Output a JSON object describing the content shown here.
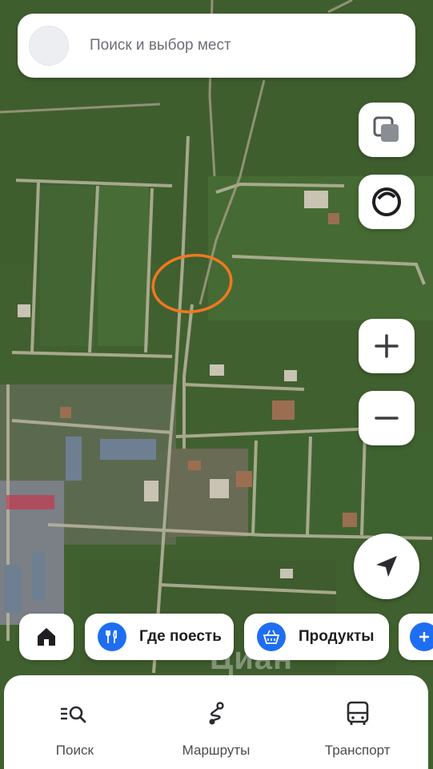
{
  "search": {
    "placeholder": "Поиск и выбор мест",
    "avatar_icon": "avatar-icon"
  },
  "map_controls": {
    "layers_icon": "layers-icon",
    "alice_icon": "alice-voice-icon",
    "zoom_in_icon": "plus-icon",
    "zoom_out_icon": "minus-icon",
    "location_icon": "navigation-arrow-icon"
  },
  "chips": [
    {
      "label": "",
      "icon": "home-icon"
    },
    {
      "label": "Где поесть",
      "icon": "fork-knife-icon"
    },
    {
      "label": "Продукты",
      "icon": "basket-icon"
    },
    {
      "label": "",
      "icon": "plus-icon"
    }
  ],
  "watermark": "Циан",
  "tabs": [
    {
      "label": "Поиск",
      "icon": "search-list-icon"
    },
    {
      "label": "Маршруты",
      "icon": "route-icon"
    },
    {
      "label": "Транспорт",
      "icon": "bus-icon"
    }
  ],
  "colors": {
    "accent": "#1f6ef1",
    "marker": "#f07820"
  }
}
